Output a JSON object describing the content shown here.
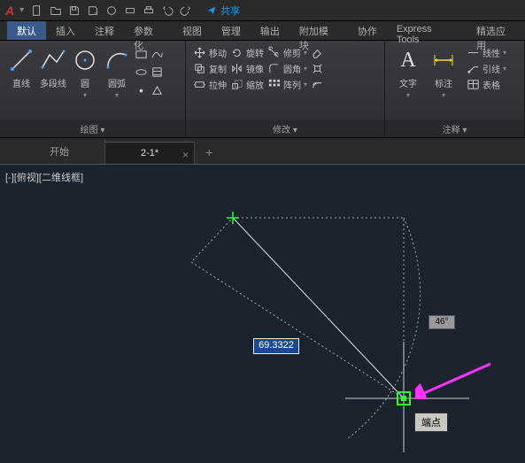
{
  "app": {
    "logo": "A"
  },
  "share": {
    "label": "共享"
  },
  "ribbon_tabs": [
    "默认",
    "插入",
    "注释",
    "参数化",
    "视图",
    "管理",
    "输出",
    "附加模块",
    "协作",
    "Express Tools",
    "精选应用"
  ],
  "panels": {
    "draw": {
      "title": "绘图 ▾",
      "tools": {
        "line": "直线",
        "polyline": "多段线",
        "circle": "圆",
        "arc": "圆弧"
      }
    },
    "modify": {
      "title": "修改 ▾",
      "tools": {
        "move": "移动",
        "rotate": "旋转",
        "trim": "修剪",
        "copy": "复制",
        "mirror": "镜像",
        "fillet": "圆角",
        "stretch": "拉伸",
        "scale": "缩放",
        "array": "阵列"
      }
    },
    "annotate": {
      "title": "注释 ▾",
      "tools": {
        "text": "文字",
        "dim": "标注",
        "linetype": "线性",
        "leader": "引线",
        "table": "表格"
      }
    }
  },
  "doc_tabs": {
    "start": "开始",
    "current": "2-1*",
    "close": "×",
    "add": "+"
  },
  "viewport": {
    "label": "[-][俯视][二维线框]",
    "dim_value": "69.3322",
    "angle": "46°",
    "snap": "端点"
  }
}
